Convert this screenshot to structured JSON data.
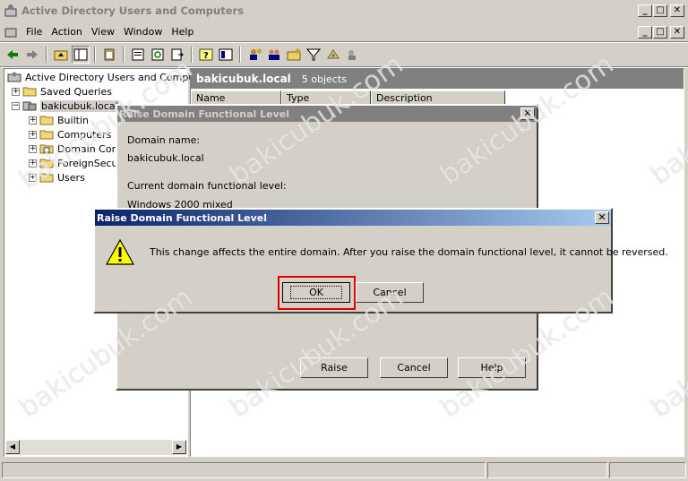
{
  "window": {
    "title": "Active Directory Users and Computers",
    "min": "_",
    "max": "□",
    "close": "✕"
  },
  "menu": {
    "items": [
      {
        "label": "File",
        "key": "F"
      },
      {
        "label": "Action",
        "key": "A"
      },
      {
        "label": "View",
        "key": "V"
      },
      {
        "label": "Window",
        "key": "W"
      },
      {
        "label": "Help",
        "key": "H"
      }
    ]
  },
  "tree": {
    "root": "Active Directory Users and Computer",
    "saved": "Saved Queries",
    "domain": "bakicubuk.local",
    "children": [
      "Builtin",
      "Computers",
      "Domain Cont",
      "ForeignSecur",
      "Users"
    ]
  },
  "right": {
    "title": "bakicubuk.local",
    "count": "5 objects",
    "columns": [
      "Name",
      "Type",
      "Description"
    ]
  },
  "dlg_back": {
    "title": "Raise Domain Functional Level",
    "domain_name_label": "Domain name:",
    "domain_name": "bakicubuk.local",
    "level_label": "Current domain functional level:",
    "level": "Windows 2000 mixed",
    "raise": "Raise",
    "cancel": "Cancel",
    "help": "Help",
    "close": "✕"
  },
  "dlg_front": {
    "title": "Raise Domain Functional Level",
    "message": "This change affects the entire domain. After you raise the domain functional level, it cannot be reversed.",
    "ok": "OK",
    "cancel": "Cancel",
    "close": "✕"
  },
  "watermark": "bakicubuk.com",
  "colors": {
    "active_title_start": "#0a246a",
    "active_title_end": "#a6caf0",
    "inactive_title": "#808080",
    "highlight_box": "#e00000"
  }
}
